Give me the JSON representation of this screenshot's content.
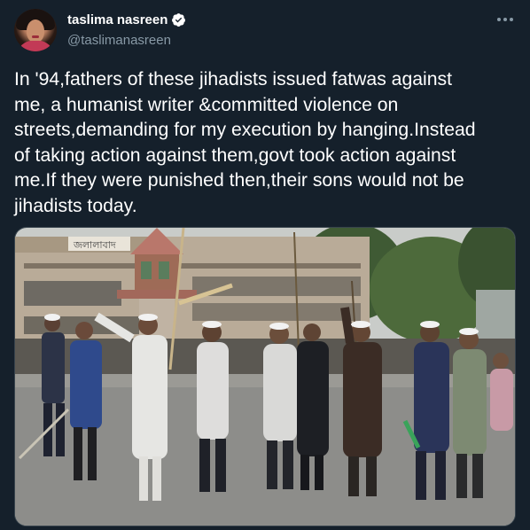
{
  "author": {
    "display_name": "taslima nasreen",
    "handle": "@taslimanasreen",
    "verified": true
  },
  "tweet": {
    "text": "In '94,fathers of these jihadists issued fatwas against\nme, a humanist writer &committed violence on\nstreets,demanding for my execution by hanging.Instead\nof taking action against them,govt took action against\nme.If they were punished then,their sons would not be\njihadists today."
  },
  "media": {
    "sign_text": "জলালাবাদ"
  },
  "icons": {
    "more": "more-horizontal-icon",
    "verified": "verified-badge-icon"
  },
  "colors": {
    "background": "#15202b",
    "text": "#ffffff",
    "secondary_text": "#8899a6",
    "verified_blue": "#1da1f2"
  }
}
